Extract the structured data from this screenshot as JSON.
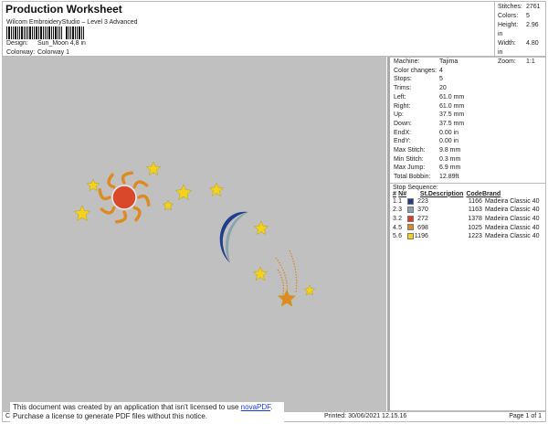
{
  "header": {
    "title": "Production Worksheet",
    "subtitle": "Wilcom EmbroideryStudio – Level 3 Advanced",
    "design_label": "Design:",
    "design_value": "Sun_Moon 4,8 in",
    "colorway_label": "Colorway:",
    "colorway_value": "Colorway 1"
  },
  "stats": [
    {
      "label": "Stitches:",
      "value": "2761"
    },
    {
      "label": "Colors:",
      "value": "5"
    },
    {
      "label": "Height:",
      "value": "2.96 in"
    },
    {
      "label": "Width:",
      "value": "4.80 in"
    },
    {
      "label": "Zoom:",
      "value": "1:1"
    }
  ],
  "properties": [
    {
      "label": "Machine:",
      "value": "Tajima"
    },
    {
      "label": "Color changes:",
      "value": "4"
    },
    {
      "label": "Stops:",
      "value": "5"
    },
    {
      "label": "Trims:",
      "value": "20"
    },
    {
      "label": "Left:",
      "value": "61.0 mm"
    },
    {
      "label": "Right:",
      "value": "61.0 mm"
    },
    {
      "label": "Up:",
      "value": "37.5 mm"
    },
    {
      "label": "Down:",
      "value": "37.5 mm"
    },
    {
      "label": "EndX:",
      "value": "0.00 in"
    },
    {
      "label": "EndY:",
      "value": "0.00 in"
    },
    {
      "label": "Max Stitch:",
      "value": "9.8 mm"
    },
    {
      "label": "Min Stitch:",
      "value": "0.3 mm"
    },
    {
      "label": "Max Jump:",
      "value": "6.9 mm"
    },
    {
      "label": "Total Bobbin:",
      "value": "12.89ft"
    }
  ],
  "stop_sequence": {
    "title": "Stop Sequence:",
    "headers": [
      "#",
      "N#",
      "St.",
      "Description",
      "Code",
      "Brand"
    ],
    "rows": [
      {
        "idx": "1.",
        "n": "1",
        "color": "#1f3f8a",
        "st": "223",
        "desc": "",
        "code": "1166",
        "brand": "Madeira Classic 40"
      },
      {
        "idx": "2.",
        "n": "3",
        "color": "#8aa3ad",
        "st": "370",
        "desc": "",
        "code": "1163",
        "brand": "Madeira Classic 40"
      },
      {
        "idx": "3.",
        "n": "2",
        "color": "#e03a22",
        "st": "272",
        "desc": "",
        "code": "1378",
        "brand": "Madeira Classic 40"
      },
      {
        "idx": "4.",
        "n": "5",
        "color": "#e08a22",
        "st": "698",
        "desc": "",
        "code": "1025",
        "brand": "Madeira Classic 40"
      },
      {
        "idx": "5.",
        "n": "6",
        "color": "#f4d21c",
        "st": "1196",
        "desc": "",
        "code": "1223",
        "brand": "Madeira Classic 40"
      }
    ]
  },
  "footer": {
    "created": "Cr",
    "printed": "Printed: 30/06/2021 12.15.16",
    "page": "Page 1 of 1"
  },
  "notice": {
    "line1": "This document was created by an application that isn't licensed to use ",
    "link": "novaPDF",
    "line1_end": ".",
    "line2": "Purchase a license to generate PDF files without this notice."
  }
}
